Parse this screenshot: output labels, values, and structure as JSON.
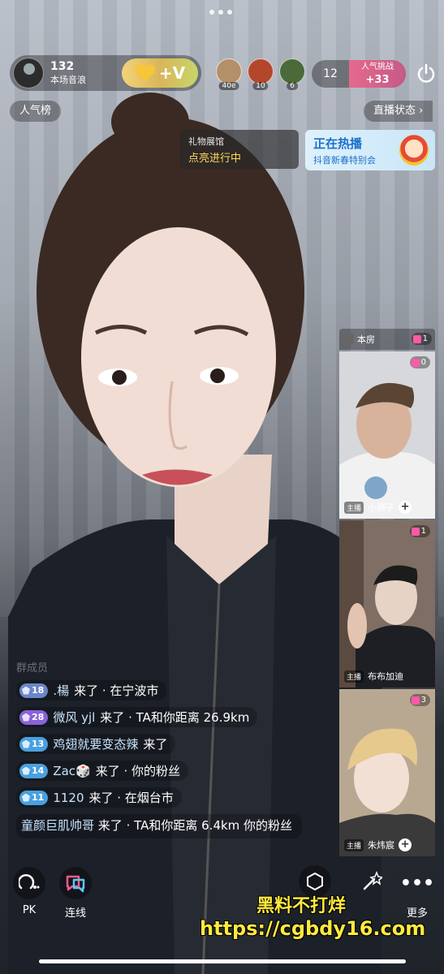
{
  "top": {
    "host": {
      "count": "132",
      "subtitle": "本场音浪",
      "badge_text": "+V"
    },
    "viewers": [
      {
        "num": "40e",
        "color": "#b38f6a"
      },
      {
        "num": "10",
        "color": "#b3472c"
      },
      {
        "num": "6",
        "color": "#4a6a3a"
      }
    ],
    "popularity": {
      "count": "12",
      "label": "人气挑战",
      "value": "+33"
    },
    "rank_label": "人气榜",
    "status_label": "直播状态 ›"
  },
  "cards": {
    "gift": {
      "title": "礼物展馆",
      "status": "点亮进行中"
    },
    "hot": {
      "title": "正在热播",
      "subtitle": "抖音新春特别会"
    }
  },
  "cohosts": {
    "header": {
      "label": "本房",
      "gifts": "1"
    },
    "tiles": [
      {
        "name": "小狮子",
        "gifts": "0",
        "tag": "主播",
        "bg": "#cfd0d2"
      },
      {
        "name": "布布加迪",
        "gifts": "1",
        "tag": "主播",
        "bg": "#8b7a6e"
      },
      {
        "name": "朱炜宸",
        "gifts": "3",
        "tag": "主播",
        "bg": "#a8967f"
      }
    ]
  },
  "chat": {
    "faded": "群成员",
    "messages": [
      {
        "level": "18",
        "style": "",
        "user": ".楊",
        "text": "来了 · 在宁波市"
      },
      {
        "level": "28",
        "style": "purple",
        "user": "微风 yjl",
        "text": "来了 · TA和你距离 26.9km"
      },
      {
        "level": "13",
        "style": "blue",
        "user": "鸡翅就要变态辣",
        "text": "来了"
      },
      {
        "level": "14",
        "style": "blue",
        "user": "Zac🎲",
        "text": "来了 · 你的粉丝"
      },
      {
        "level": "11",
        "style": "blue",
        "user": "1120",
        "text": "来了 · 在烟台市"
      }
    ],
    "long_message": {
      "user": "童颜巨肌帅哥",
      "text": "来了 · TA和你距离 6.4km 你的粉丝"
    }
  },
  "bottom": {
    "pk_label": "PK",
    "link_label": "连线",
    "more_label": "更多"
  },
  "watermark": {
    "line1": "黑料不打烊",
    "line2": "https://cgbdy16.com"
  }
}
